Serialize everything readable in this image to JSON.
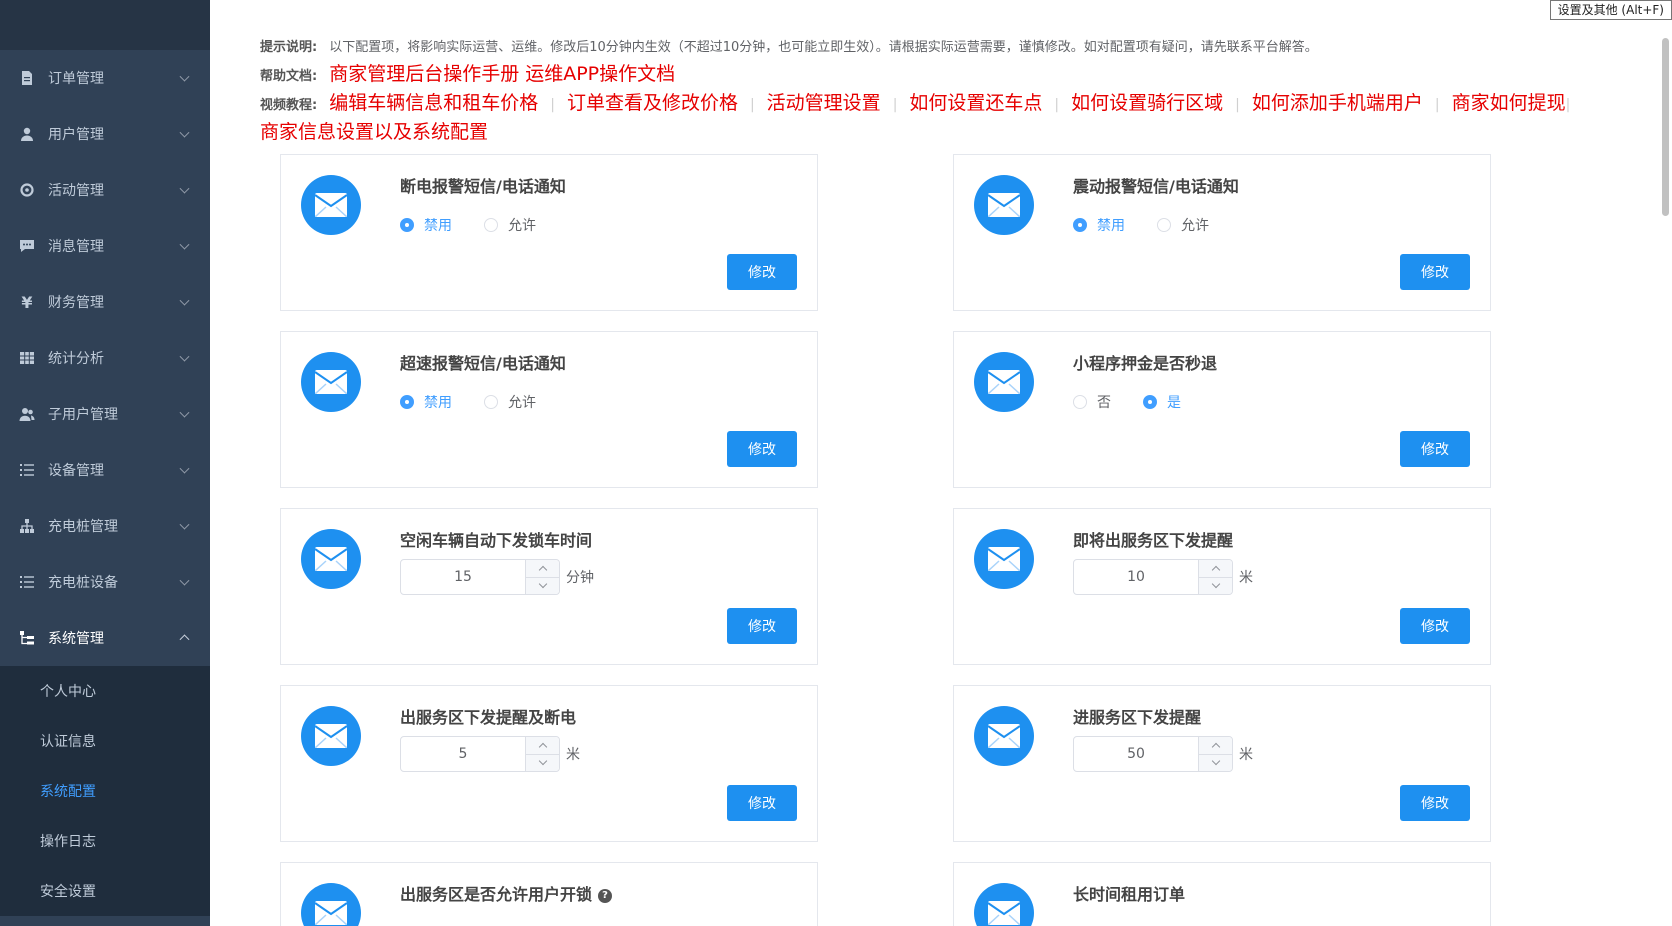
{
  "tooltip": "设置及其他 (Alt+F)",
  "sidebar": {
    "items": [
      {
        "label": "订单管理",
        "icon": "document-icon"
      },
      {
        "label": "用户管理",
        "icon": "user-icon"
      },
      {
        "label": "活动管理",
        "icon": "target-icon"
      },
      {
        "label": "消息管理",
        "icon": "chat-icon"
      },
      {
        "label": "财务管理",
        "icon": "yen-icon"
      },
      {
        "label": "统计分析",
        "icon": "grid-icon"
      },
      {
        "label": "子用户管理",
        "icon": "users-icon"
      },
      {
        "label": "设备管理",
        "icon": "list-icon"
      },
      {
        "label": "充电桩管理",
        "icon": "org-icon"
      },
      {
        "label": "充电桩设备",
        "icon": "list-icon"
      },
      {
        "label": "系统管理",
        "icon": "tree-icon"
      }
    ],
    "subitems": [
      {
        "label": "个人中心"
      },
      {
        "label": "认证信息"
      },
      {
        "label": "系统配置"
      },
      {
        "label": "操作日志"
      },
      {
        "label": "安全设置"
      }
    ]
  },
  "info": {
    "tip_label": "提示说明:",
    "tip_text": "以下配置项，将影响实际运营、运维。修改后10分钟内生效（不超过10分钟，也可能立即生效）。请根据实际运营需要，谨慎修改。如对配置项有疑问，请先联系平台解答。",
    "doc_label": "帮助文档:",
    "doc_links": [
      "商家管理后台操作手册",
      "运维APP操作文档"
    ],
    "video_label": "视频教程:",
    "video_links": [
      "编辑车辆信息和租车价格",
      "订单查看及修改价格",
      "活动管理设置",
      "如何设置还车点",
      "如何设置骑行区域",
      "如何添加手机端用户",
      "商家如何提现",
      "商家信息设置以及系统配置"
    ]
  },
  "cards": [
    {
      "title": "断电报警短信/电话通知",
      "options": [
        "禁用",
        "允许"
      ],
      "selected": 0,
      "button": "修改"
    },
    {
      "title": "震动报警短信/电话通知",
      "options": [
        "禁用",
        "允许"
      ],
      "selected": 0,
      "button": "修改"
    },
    {
      "title": "超速报警短信/电话通知",
      "options": [
        "禁用",
        "允许"
      ],
      "selected": 0,
      "button": "修改"
    },
    {
      "title": "小程序押金是否秒退",
      "options": [
        "否",
        "是"
      ],
      "selected": 1,
      "button": "修改"
    },
    {
      "title": "空闲车辆自动下发锁车时间",
      "value": "15",
      "unit": "分钟",
      "button": "修改"
    },
    {
      "title": "即将出服务区下发提醒",
      "value": "10",
      "unit": "米",
      "button": "修改"
    },
    {
      "title": "出服务区下发提醒及断电",
      "value": "5",
      "unit": "米",
      "button": "修改"
    },
    {
      "title": "进服务区下发提醒",
      "value": "50",
      "unit": "米",
      "button": "修改"
    },
    {
      "title": "出服务区是否允许用户开锁",
      "help": "?"
    },
    {
      "title": "长时间租用订单"
    }
  ]
}
